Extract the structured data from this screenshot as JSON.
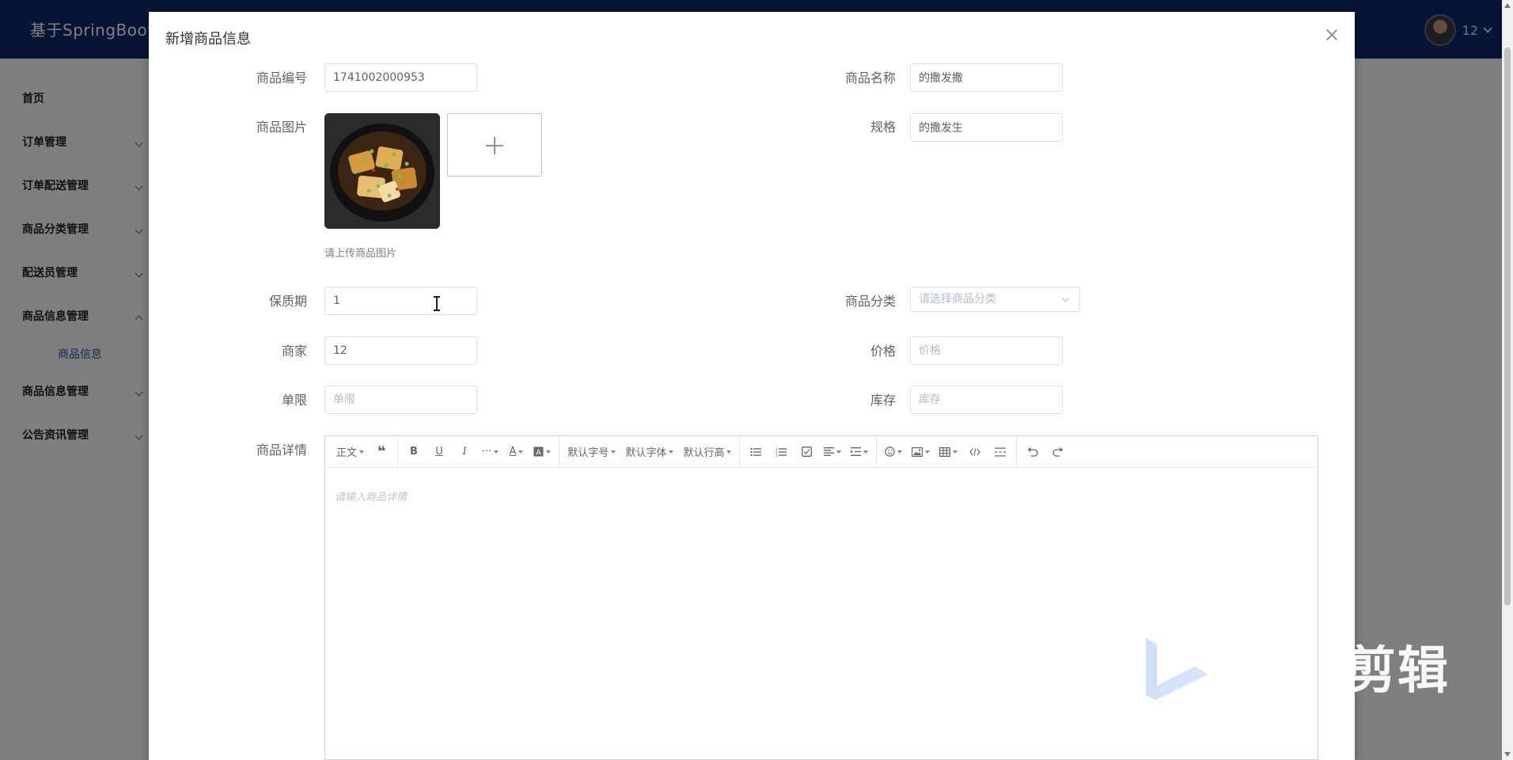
{
  "app": {
    "title": "基于SpringBoot",
    "user_name": "12"
  },
  "sidebar": {
    "items": [
      {
        "label": "首页",
        "expandable": false
      },
      {
        "label": "订单管理",
        "expandable": true
      },
      {
        "label": "订单配送管理",
        "expandable": true
      },
      {
        "label": "商品分类管理",
        "expandable": true
      },
      {
        "label": "配送员管理",
        "expandable": true
      },
      {
        "label": "商品信息管理",
        "expandable": true,
        "open": true,
        "children": [
          "商品信息"
        ]
      },
      {
        "label": "商品信息管理",
        "expandable": true
      },
      {
        "label": "公告资讯管理",
        "expandable": true
      }
    ]
  },
  "dialog": {
    "title": "新增商品信息",
    "close_icon": "close-icon",
    "fields": {
      "product_no": {
        "label": "商品编号",
        "value": "1741002000953"
      },
      "product_name": {
        "label": "商品名称",
        "value": "的撒发撒"
      },
      "product_image": {
        "label": "商品图片",
        "tip": "请上传商品图片"
      },
      "spec": {
        "label": "规格",
        "value": "的撒发生"
      },
      "shelf_life": {
        "label": "保质期",
        "value": "1"
      },
      "category": {
        "label": "商品分类",
        "placeholder": "请选择商品分类"
      },
      "merchant": {
        "label": "商家",
        "value": "12"
      },
      "price": {
        "label": "价格",
        "placeholder": "价格"
      },
      "limit": {
        "label": "单限",
        "placeholder": "单限"
      },
      "stock": {
        "label": "库存",
        "placeholder": "库存"
      },
      "detail": {
        "label": "商品详情",
        "placeholder": "请输入商品详情"
      }
    },
    "editor_toolbar": {
      "paragraph": "正文",
      "font_size": "默认字号",
      "font_family": "默认字体",
      "line_height": "默认行高",
      "more": "···",
      "text_color": "A"
    }
  },
  "watermark": {
    "text": "剪辑"
  }
}
